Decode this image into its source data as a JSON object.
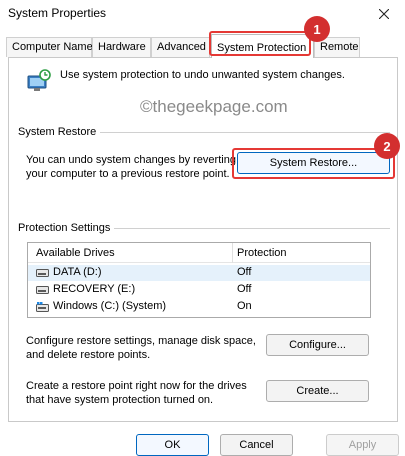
{
  "window": {
    "title": "System Properties"
  },
  "tabs": [
    {
      "label": "Computer Name"
    },
    {
      "label": "Hardware"
    },
    {
      "label": "Advanced"
    },
    {
      "label": "System Protection"
    },
    {
      "label": "Remote"
    }
  ],
  "intro": {
    "text": "Use system protection to undo unwanted system changes."
  },
  "watermark": "©thegeekpage.com",
  "system_restore": {
    "group_label": "System Restore",
    "description": "You can undo system changes by reverting your computer to a previous restore point.",
    "button_label": "System Restore..."
  },
  "protection": {
    "group_label": "Protection Settings",
    "columns": [
      "Available Drives",
      "Protection"
    ],
    "drives": [
      {
        "name": "DATA (D:)",
        "protection": "Off"
      },
      {
        "name": "RECOVERY (E:)",
        "protection": "Off"
      },
      {
        "name": "Windows (C:) (System)",
        "protection": "On"
      }
    ],
    "configure_text": "Configure restore settings, manage disk space, and delete restore points.",
    "configure_label": "Configure...",
    "create_text": "Create a restore point right now for the drives that have system protection turned on.",
    "create_label": "Create..."
  },
  "footer": {
    "ok_label": "OK",
    "cancel_label": "Cancel",
    "apply_label": "Apply"
  },
  "annotations": {
    "badge1": "1",
    "badge2": "2"
  },
  "colors": {
    "annotation": "#e53935",
    "selection": "#e5f1fb",
    "accent": "#0067c0"
  }
}
